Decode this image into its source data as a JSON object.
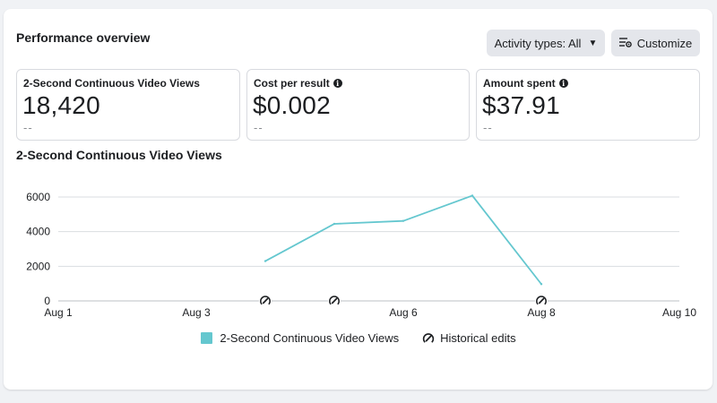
{
  "header": {
    "title": "Performance overview",
    "activity_button": "Activity types: All",
    "customize_button": "Customize"
  },
  "metrics": [
    {
      "label": "2-Second Continuous Video Views",
      "value": "18,420",
      "sub": "--",
      "info": false
    },
    {
      "label": "Cost per result",
      "value": "$0.002",
      "sub": "--",
      "info": true
    },
    {
      "label": "Amount spent",
      "value": "$37.91",
      "sub": "--",
      "info": true
    }
  ],
  "chart_title": "2-Second Continuous Video Views",
  "legend": {
    "series_label": "2-Second Continuous Video Views",
    "edits_label": "Historical edits"
  },
  "colors": {
    "series": "#64c7cf",
    "grid": "#dadde1",
    "text": "#1c1e21",
    "muted": "#8a8d91"
  },
  "chart_data": {
    "type": "line",
    "title": "2-Second Continuous Video Views",
    "xlabel": "",
    "ylabel": "",
    "x_ticks": [
      "Aug 1",
      "Aug 3",
      "Aug 6",
      "Aug 8",
      "Aug 10"
    ],
    "x_tick_days": [
      1,
      3,
      6,
      8,
      10
    ],
    "xlim": [
      1,
      10
    ],
    "ylim": [
      0,
      6000
    ],
    "y_ticks": [
      0,
      2000,
      4000,
      6000
    ],
    "grid": true,
    "legend_position": "bottom-center",
    "series": [
      {
        "name": "2-Second Continuous Video Views",
        "x": [
          4,
          5,
          6,
          7,
          8
        ],
        "y": [
          2300,
          4450,
          4620,
          6080,
          970
        ]
      }
    ],
    "historical_edits_x": [
      4,
      5,
      8
    ]
  }
}
